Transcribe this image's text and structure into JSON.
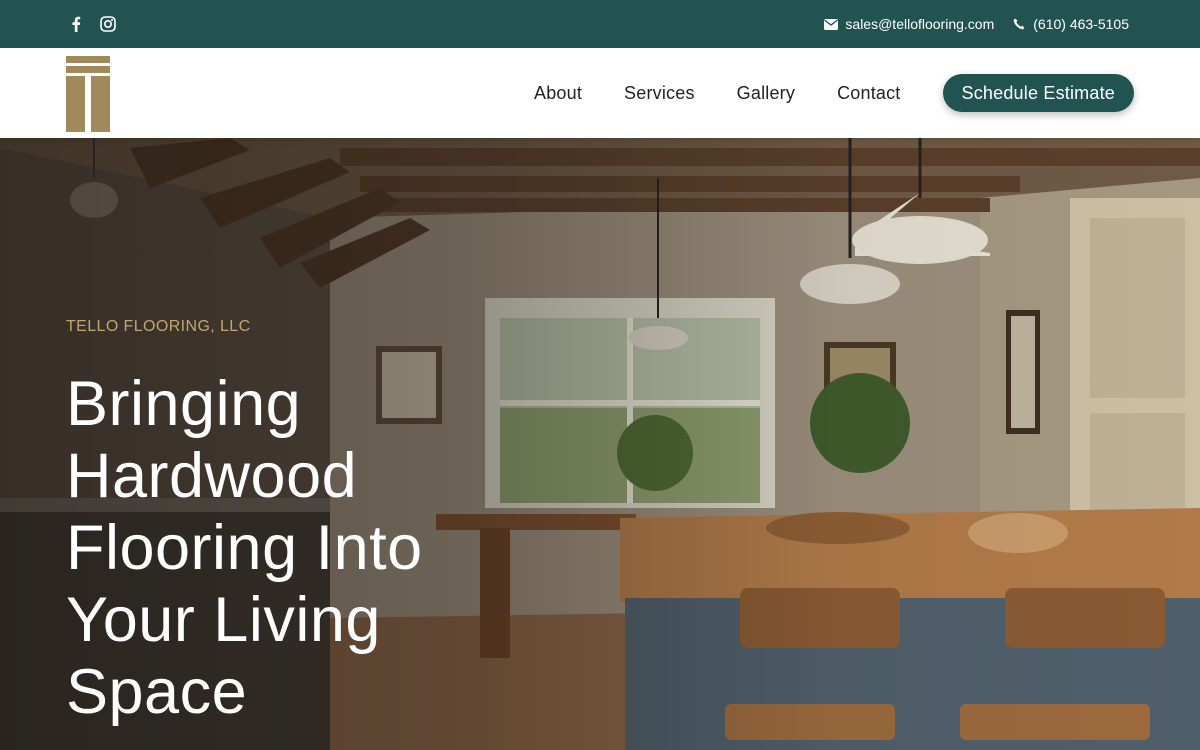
{
  "topbar": {
    "social": [
      {
        "icon": "facebook-icon",
        "glyph": "f"
      },
      {
        "icon": "instagram-icon"
      }
    ],
    "email": "sales@telloflooring.com",
    "phone": "(610) 463-5105"
  },
  "header": {
    "nav": [
      "About",
      "Services",
      "Gallery",
      "Contact"
    ],
    "cta_label": "Schedule Estimate"
  },
  "hero": {
    "eyebrow": "TELLO FLOORING, LLC",
    "headline": "Bringing Hardwood Flooring Into Your Living Space"
  },
  "colors": {
    "brand_green": "#215351",
    "logo_gold": "#a08a5c",
    "eyebrow_gold": "#c2a470"
  }
}
